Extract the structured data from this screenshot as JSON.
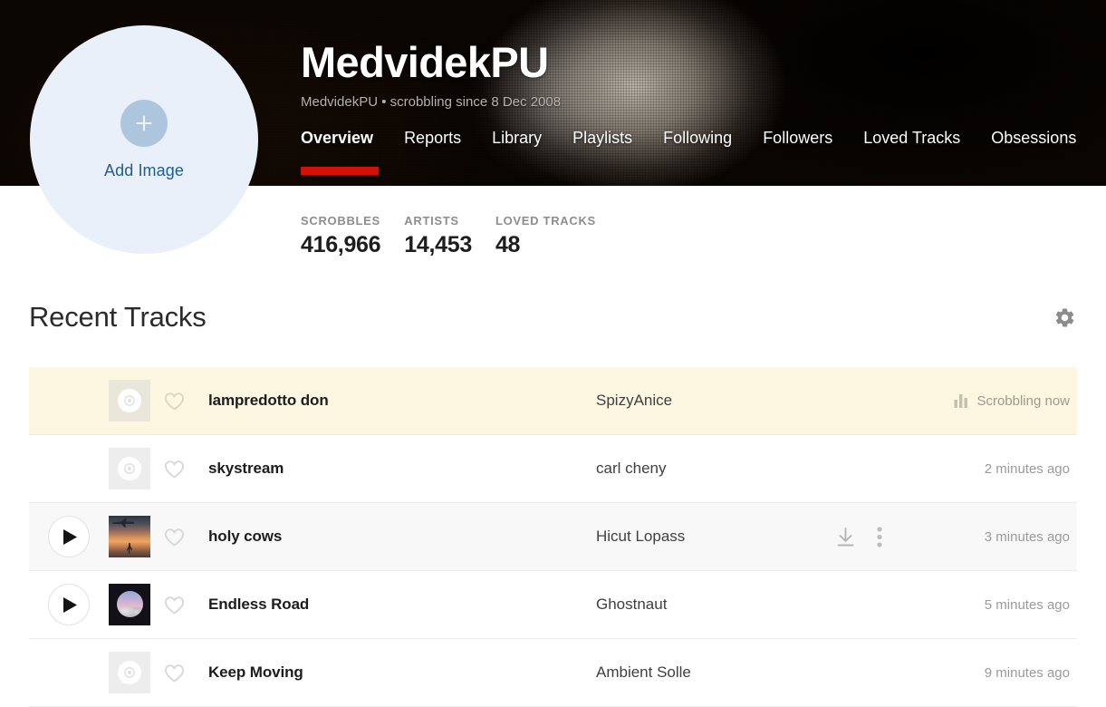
{
  "profile": {
    "username": "MedvidekPU",
    "subtitle": "MedvidekPU • scrobbling since 8 Dec 2008",
    "avatar": {
      "add_image_label": "Add Image",
      "plus_icon": "plus-icon"
    },
    "accent_color": "#d51007"
  },
  "nav": {
    "tabs": [
      {
        "label": "Overview",
        "active": true
      },
      {
        "label": "Reports",
        "active": false
      },
      {
        "label": "Library",
        "active": false
      },
      {
        "label": "Playlists",
        "active": false
      },
      {
        "label": "Following",
        "active": false
      },
      {
        "label": "Followers",
        "active": false
      },
      {
        "label": "Loved Tracks",
        "active": false
      },
      {
        "label": "Obsessions",
        "active": false
      }
    ]
  },
  "stats": [
    {
      "label": "SCROBBLES",
      "value": "416,966"
    },
    {
      "label": "ARTISTS",
      "value": "14,453"
    },
    {
      "label": "LOVED TRACKS",
      "value": "48"
    }
  ],
  "recent_tracks": {
    "title": "Recent Tracks",
    "settings_icon": "gear-icon",
    "rows": [
      {
        "title": "lampredotto don",
        "artist": "SpizyAnice",
        "time": "Scrobbling now",
        "state": "now-playing",
        "art": "placeholder",
        "love_icon": "heart-icon",
        "status_icon": "equalizer-icon",
        "show_play": false,
        "show_actions": false
      },
      {
        "title": "skystream",
        "artist": "carl cheny",
        "time": "2 minutes ago",
        "state": "normal",
        "art": "placeholder",
        "love_icon": "heart-icon",
        "show_play": false,
        "show_actions": false
      },
      {
        "title": "holy cows",
        "artist": "Hicut Lopass",
        "time": "3 minutes ago",
        "state": "hovered",
        "art": "sunset",
        "love_icon": "heart-icon",
        "show_play": true,
        "show_actions": true,
        "download_icon": "download-icon",
        "more_icon": "more-vertical-icon",
        "play_icon": "play-icon"
      },
      {
        "title": "Endless Road",
        "artist": "Ghostnaut",
        "time": "5 minutes ago",
        "state": "normal",
        "art": "pastel",
        "love_icon": "heart-icon",
        "show_play": true,
        "show_actions": false,
        "play_icon": "play-icon"
      },
      {
        "title": "Keep Moving",
        "artist": "Ambient Solle",
        "time": "9 minutes ago",
        "state": "normal",
        "art": "placeholder",
        "love_icon": "heart-icon",
        "show_play": false,
        "show_actions": false
      }
    ]
  }
}
